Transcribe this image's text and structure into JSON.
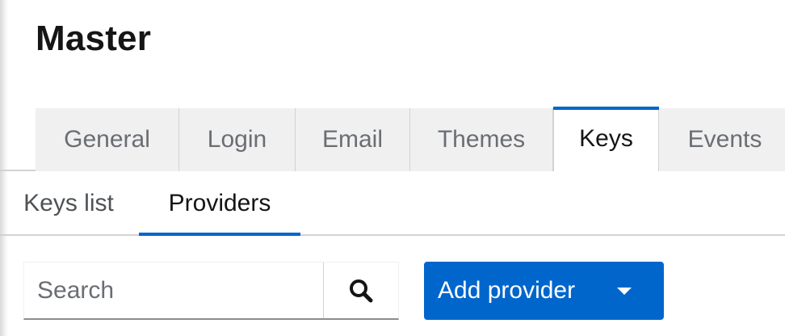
{
  "page": {
    "title": "Master"
  },
  "top_tabs": [
    {
      "label": "General",
      "active": false
    },
    {
      "label": "Login",
      "active": false
    },
    {
      "label": "Email",
      "active": false
    },
    {
      "label": "Themes",
      "active": false
    },
    {
      "label": "Keys",
      "active": true
    },
    {
      "label": "Events",
      "active": false
    }
  ],
  "sub_tabs": [
    {
      "label": "Keys list",
      "active": false
    },
    {
      "label": "Providers",
      "active": true
    }
  ],
  "toolbar": {
    "search_placeholder": "Search",
    "search_value": "",
    "search_icon": "search-icon",
    "add_provider_label": "Add provider",
    "add_provider_icon": "caret-down-icon"
  },
  "colors": {
    "accent": "#0066cc",
    "tab_inactive_bg": "#f0f0f0",
    "text_primary": "#151515",
    "text_secondary": "#6a6e73"
  }
}
